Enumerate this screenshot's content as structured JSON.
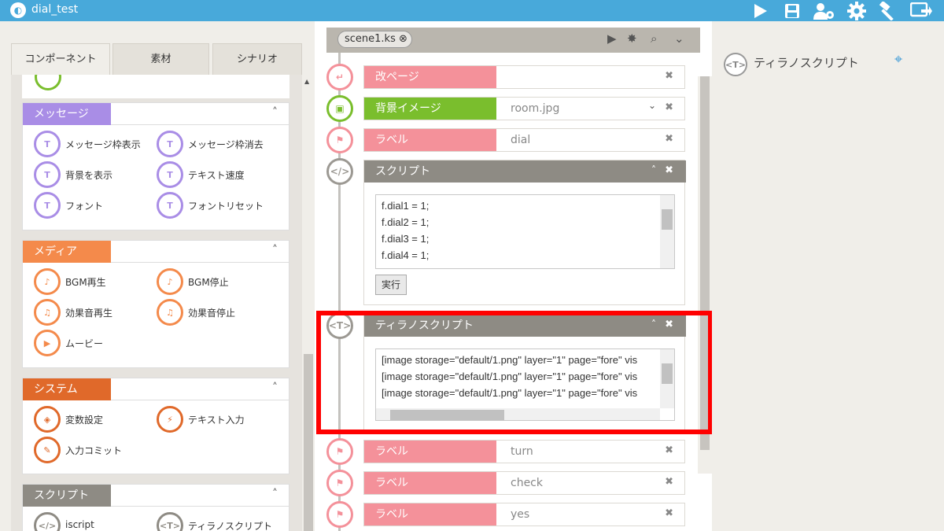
{
  "app": {
    "title": "dial_test",
    "logo_glyph": "◐"
  },
  "toolbar": [
    {
      "name": "run-icon",
      "glyph": "▶"
    },
    {
      "name": "save-icon",
      "glyph": "💾"
    },
    {
      "name": "users-settings-icon",
      "glyph": "⚙"
    },
    {
      "name": "gear-icon",
      "glyph": "⚙"
    },
    {
      "name": "build-icon",
      "glyph": "⚒"
    },
    {
      "name": "export-icon",
      "glyph": "⇲"
    }
  ],
  "left_tabs": [
    "コンポーネント",
    "素材",
    "シナリオ"
  ],
  "categories": [
    {
      "name": "メッセージ",
      "color": "#a98de6",
      "items": [
        {
          "label": "メッセージ枠表示",
          "icon": "message-window-show-icon",
          "glyph": "T"
        },
        {
          "label": "メッセージ枠消去",
          "icon": "message-window-hide-icon",
          "glyph": "T"
        },
        {
          "label": "背景を表示",
          "icon": "show-background-icon",
          "glyph": "T"
        },
        {
          "label": "テキスト速度",
          "icon": "text-speed-icon",
          "glyph": "T"
        },
        {
          "label": "フォント",
          "icon": "font-icon",
          "glyph": "T"
        },
        {
          "label": "フォントリセット",
          "icon": "font-reset-icon",
          "glyph": "T"
        }
      ]
    },
    {
      "name": "メディア",
      "color": "#f48a4b",
      "items": [
        {
          "label": "BGM再生",
          "icon": "bgm-play-icon",
          "glyph": "♪"
        },
        {
          "label": "BGM停止",
          "icon": "bgm-stop-icon",
          "glyph": "♪"
        },
        {
          "label": "効果音再生",
          "icon": "se-play-icon",
          "glyph": "♫"
        },
        {
          "label": "効果音停止",
          "icon": "se-stop-icon",
          "glyph": "♫"
        },
        {
          "label": "ムービー",
          "icon": "movie-icon",
          "glyph": "▶"
        }
      ]
    },
    {
      "name": "システム",
      "color": "#e0692a",
      "items": [
        {
          "label": "変数設定",
          "icon": "variable-icon",
          "glyph": "◈"
        },
        {
          "label": "テキスト入力",
          "icon": "text-input-icon",
          "glyph": "⚡"
        },
        {
          "label": "入力コミット",
          "icon": "input-commit-icon",
          "glyph": "✎"
        }
      ]
    },
    {
      "name": "スクリプト",
      "color": "#8e8b84",
      "items": [
        {
          "label": "iscript",
          "icon": "iscript-icon",
          "glyph": "</>"
        },
        {
          "label": "ティラノスクリプト",
          "icon": "tyranoscript-icon",
          "glyph": "<T>"
        }
      ]
    }
  ],
  "scene_tab": {
    "label": "scene1.ks",
    "close": "⊗"
  },
  "scene_tools": [
    "▶",
    "✸",
    "⌕",
    "⌄"
  ],
  "blocks": [
    {
      "title": "改ページ",
      "value": "",
      "color": "#f4919a",
      "icon_glyph": "↵",
      "icon_color": "#f4919a",
      "icon_name": "page-break-icon"
    },
    {
      "title": "背景イメージ",
      "value": "room.jpg",
      "color": "#7abe2d",
      "icon_glyph": "▣",
      "icon_color": "#7abe2d",
      "icon_name": "background-image-icon",
      "has_dropdown": true
    },
    {
      "title": "ラベル",
      "value": "dial",
      "color": "#f4919a",
      "icon_glyph": "⚑",
      "icon_color": "#f4919a",
      "icon_name": "label-flag-icon"
    },
    {
      "title": "スクリプト",
      "value": "",
      "color": "#8e8b84",
      "icon_glyph": "</>",
      "icon_color": "#9c9993",
      "icon_name": "script-icon",
      "lines": [
        "f.dial1 = 1;",
        "f.dial2 = 1;",
        "f.dial3 = 1;",
        "f.dial4 = 1;"
      ],
      "button": "実行"
    },
    {
      "title": "ティラノスクリプト",
      "value": "",
      "color": "#8e8b84",
      "icon_glyph": "<T>",
      "icon_color": "#9c9993",
      "icon_name": "tyranoscript-icon",
      "lines": [
        "[image storage=\"default/1.png\" layer=\"1\" page=\"fore\" vis",
        "[image storage=\"default/1.png\" layer=\"1\" page=\"fore\" vis",
        "[image storage=\"default/1.png\" layer=\"1\" page=\"fore\" vis"
      ]
    },
    {
      "title": "ラベル",
      "value": "turn",
      "color": "#f4919a",
      "icon_glyph": "⚑",
      "icon_color": "#f4919a",
      "icon_name": "label-flag-icon"
    },
    {
      "title": "ラベル",
      "value": "check",
      "color": "#f4919a",
      "icon_glyph": "⚑",
      "icon_color": "#f4919a",
      "icon_name": "label-flag-icon"
    },
    {
      "title": "ラベル",
      "value": "yes",
      "color": "#f4919a",
      "icon_glyph": "⚑",
      "icon_color": "#f4919a",
      "icon_name": "label-flag-icon"
    }
  ],
  "right_panel": {
    "title": "ティラノスクリプト",
    "icon_glyph": "<T>",
    "pin_glyph": "⌖"
  },
  "glyphs": {
    "close": "✖",
    "collapse": "˄",
    "chevron_up": "˄",
    "dropdown": "⌄"
  }
}
